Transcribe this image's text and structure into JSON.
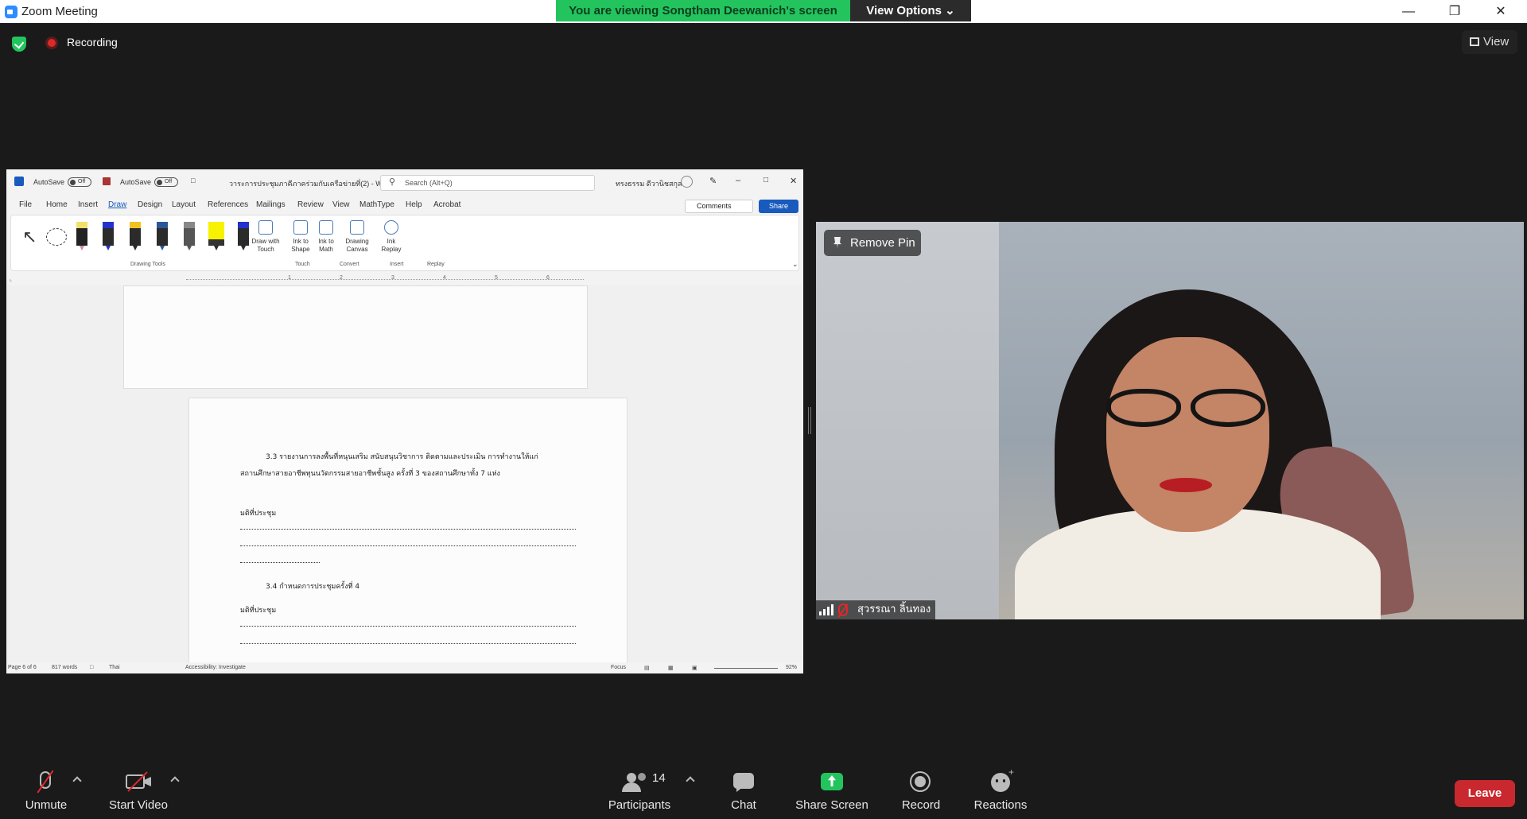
{
  "window": {
    "title": "Zoom Meeting",
    "share_banner": "You are viewing Songtham Deewanich's screen",
    "view_options": "View Options"
  },
  "topbar": {
    "recording": "Recording",
    "view": "View"
  },
  "word": {
    "autosave1": "AutoSave",
    "autosave1_state": "Off",
    "autosave2": "AutoSave",
    "autosave2_state": "Off",
    "doc_title": "วาระการประชุมภาคีภาคร่วมกับเครือข่ายที่(2)  -  Word",
    "search_placeholder": "Search (Alt+Q)",
    "user": "ทรงธรรม ดีวานิชสกุล",
    "menu": [
      "File",
      "Home",
      "Insert",
      "Draw",
      "Design",
      "Layout",
      "References",
      "Mailings",
      "Review",
      "View",
      "MathType",
      "Help",
      "Acrobat"
    ],
    "comments": "Comments",
    "share": "Share",
    "ribbon": {
      "draw_with_touch": "Draw with Touch",
      "ink_to_shape": "Ink to Shape",
      "ink_to_math": "Ink to Math",
      "drawing_canvas": "Drawing Canvas",
      "ink_replay": "Ink Replay",
      "groups": [
        "Drawing Tools",
        "Touch",
        "Convert",
        "Insert",
        "Replay"
      ]
    },
    "ruler_marks": [
      "1",
      "2",
      "3",
      "4",
      "5",
      "6"
    ],
    "doc": {
      "line1": "3.3 รายงานการลงพื้นที่หนุนเสริม สนับสนุนวิชาการ ติดตามและประเมิน การทำงานให้แก่",
      "line2": "สถานศึกษาสายอาชีพทุนนวัตกรรมสายอาชีพชั้นสูง ครั้งที่ 3 ของสถานศึกษาทั้ง 7 แห่ง",
      "resolution1": "มติที่ประชุม",
      "item34": "3.4 กำหนดการประชุมครั้งที่ 4",
      "resolution2": "มติที่ประชุม"
    },
    "status": {
      "page": "Page 6 of 6",
      "words": "817 words",
      "language": "Thai",
      "accessibility": "Accessibility: Investigate",
      "focus": "Focus",
      "zoom": "92%"
    }
  },
  "video": {
    "remove_pin": "Remove Pin",
    "participant_name": "สุวรรณา ลิ้นทอง"
  },
  "toolbar": {
    "unmute": "Unmute",
    "start_video": "Start Video",
    "participants": "Participants",
    "participant_count": "14",
    "chat": "Chat",
    "share_screen": "Share Screen",
    "record": "Record",
    "reactions": "Reactions",
    "leave": "Leave"
  },
  "colors": {
    "share_green": "#23c45e",
    "leave_red": "#c8282e",
    "word_blue": "#185abd"
  }
}
